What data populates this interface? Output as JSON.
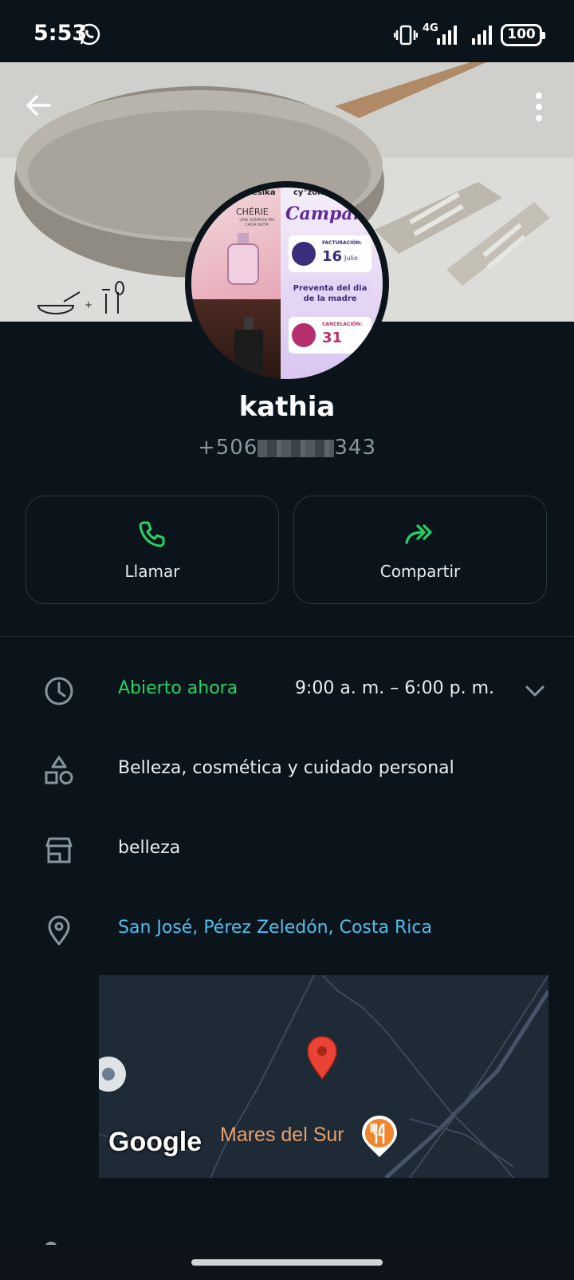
{
  "status": {
    "time": "5:53",
    "network": "4G",
    "battery": "100"
  },
  "profile": {
    "name": "kathia",
    "phone_prefix": "+506",
    "phone_suffix": "343"
  },
  "avatar_text": {
    "brands": [
      "esika",
      "cy°zone"
    ],
    "perfume": "CHÉRIE",
    "perfume_tag": "UNA SONRISA EN CADA NOTA",
    "campaign": "Campaña",
    "billing_label": "FACTURACIÓN:",
    "billing_day": "16",
    "billing_month": "Julio",
    "presale": "Preventa del dia de la madre",
    "cancel_label": "CANCELACIÓN:",
    "cancel_day": "31"
  },
  "actions": {
    "call": "Llamar",
    "share": "Compartir"
  },
  "info": {
    "hours_status": "Abierto ahora",
    "hours_range": "9:00 a. m. – 6:00 p. m.",
    "category": "Belleza, cosmética y cuidado personal",
    "store": "belleza",
    "address": "San José, Pérez Zeledón, Costa Rica"
  },
  "map": {
    "provider": "Google",
    "poi": "Mares del Sur"
  },
  "colors": {
    "accent": "#25d366",
    "link": "#53bdeb",
    "background": "#0b141a",
    "poi": "#f0862e",
    "pin": "#ea4335"
  }
}
